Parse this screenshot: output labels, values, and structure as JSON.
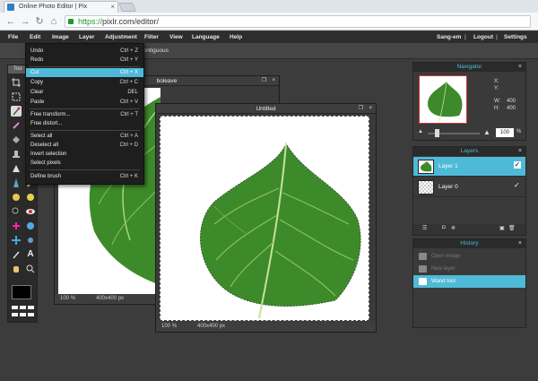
{
  "browser": {
    "tab_title": "Online Photo Editor | Pix",
    "url_scheme": "https://",
    "url_rest": "pixlr.com/editor/"
  },
  "menubar": {
    "items": [
      "File",
      "Edit",
      "Image",
      "Layer",
      "Adjustment",
      "Filter",
      "View",
      "Language",
      "Help"
    ],
    "user": "Sang-em",
    "logout": "Logout",
    "settings": "Settings"
  },
  "options": {
    "contiguous": "Contiguous"
  },
  "toolbox": {
    "title": "Too"
  },
  "edit_menu": {
    "items": [
      {
        "label": "Undo",
        "shortcut": "Ctrl + Z"
      },
      {
        "label": "Redo",
        "shortcut": "Ctrl + Y"
      },
      {
        "label": "Cut",
        "shortcut": "Ctrl + X",
        "highlighted": true
      },
      {
        "label": "Copy",
        "shortcut": "Ctrl + C"
      },
      {
        "label": "Clear",
        "shortcut": "DEL"
      },
      {
        "label": "Paste",
        "shortcut": "Ctrl + V"
      },
      {
        "label": "Free transform...",
        "shortcut": "Ctrl + T"
      },
      {
        "label": "Free distort...",
        "shortcut": ""
      },
      {
        "label": "Select all",
        "shortcut": "Ctrl + A"
      },
      {
        "label": "Deselect all",
        "shortcut": "Ctrl + D"
      },
      {
        "label": "Invert selection",
        "shortcut": ""
      },
      {
        "label": "Select pixels",
        "shortcut": ""
      },
      {
        "label": "Define brush",
        "shortcut": "Ctrl + K"
      }
    ]
  },
  "doc_back": {
    "title": "boleave",
    "zoom": "100",
    "zoom_unit": "%",
    "size": "400x400",
    "size_unit": "px"
  },
  "doc_front": {
    "title": "Untitled",
    "zoom": "100",
    "zoom_unit": "%",
    "size": "400x400",
    "size_unit": "px"
  },
  "navigator": {
    "title": "Navigator",
    "x_label": "X:",
    "y_label": "Y:",
    "w_label": "W:",
    "w_value": "400",
    "h_label": "H:",
    "h_value": "400",
    "zoom_value": "100",
    "zoom_unit": "%"
  },
  "layers": {
    "title": "Layers",
    "items": [
      {
        "name": "Layer 1",
        "selected": true,
        "check": "✓"
      },
      {
        "name": "Layer 0",
        "selected": false,
        "check": "✓"
      }
    ]
  },
  "history": {
    "title": "History",
    "items": [
      {
        "label": "Open image",
        "selected": false
      },
      {
        "label": "New layer",
        "selected": false
      },
      {
        "label": "Wand tool",
        "selected": true
      }
    ]
  },
  "colors": {
    "accent": "#4fb9d8",
    "leaf": "#3d8a2a",
    "leaf_light": "#6db33f"
  }
}
